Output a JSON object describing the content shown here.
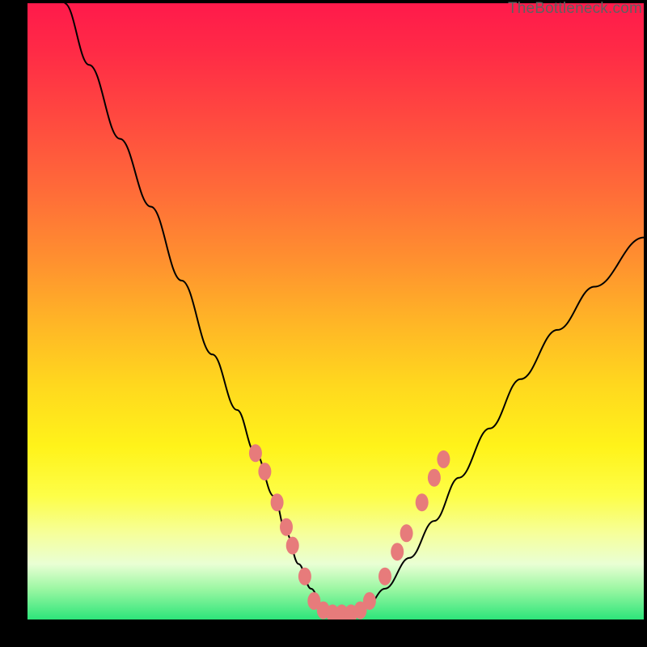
{
  "watermark": "TheBottleneck.com",
  "chart_data": {
    "type": "line",
    "title": "",
    "xlabel": "",
    "ylabel": "",
    "xlim": [
      0,
      100
    ],
    "ylim": [
      0,
      100
    ],
    "grid": false,
    "series": [
      {
        "name": "bottleneck-curve",
        "x": [
          6,
          10,
          15,
          20,
          25,
          30,
          34,
          37,
          40,
          42,
          44,
          46,
          48,
          50,
          52,
          55,
          58,
          62,
          66,
          70,
          75,
          80,
          86,
          92,
          100
        ],
        "y": [
          100,
          90,
          78,
          67,
          55,
          43,
          34,
          27,
          20,
          14,
          9,
          5,
          2,
          1,
          1,
          2,
          5,
          10,
          16,
          23,
          31,
          39,
          47,
          54,
          62
        ]
      }
    ],
    "markers": {
      "name": "highlight-beads",
      "points": [
        {
          "x": 37.0,
          "y": 27
        },
        {
          "x": 38.5,
          "y": 24
        },
        {
          "x": 40.5,
          "y": 19
        },
        {
          "x": 42.0,
          "y": 15
        },
        {
          "x": 43.0,
          "y": 12
        },
        {
          "x": 45.0,
          "y": 7
        },
        {
          "x": 46.5,
          "y": 3
        },
        {
          "x": 48.0,
          "y": 1.5
        },
        {
          "x": 49.5,
          "y": 1
        },
        {
          "x": 51.0,
          "y": 1
        },
        {
          "x": 52.5,
          "y": 1
        },
        {
          "x": 54.0,
          "y": 1.5
        },
        {
          "x": 55.5,
          "y": 3
        },
        {
          "x": 58.0,
          "y": 7
        },
        {
          "x": 60.0,
          "y": 11
        },
        {
          "x": 61.5,
          "y": 14
        },
        {
          "x": 64.0,
          "y": 19
        },
        {
          "x": 66.0,
          "y": 23
        },
        {
          "x": 67.5,
          "y": 26
        }
      ]
    },
    "colors": {
      "curve": "#000000",
      "marker": "#e77b7b"
    }
  }
}
